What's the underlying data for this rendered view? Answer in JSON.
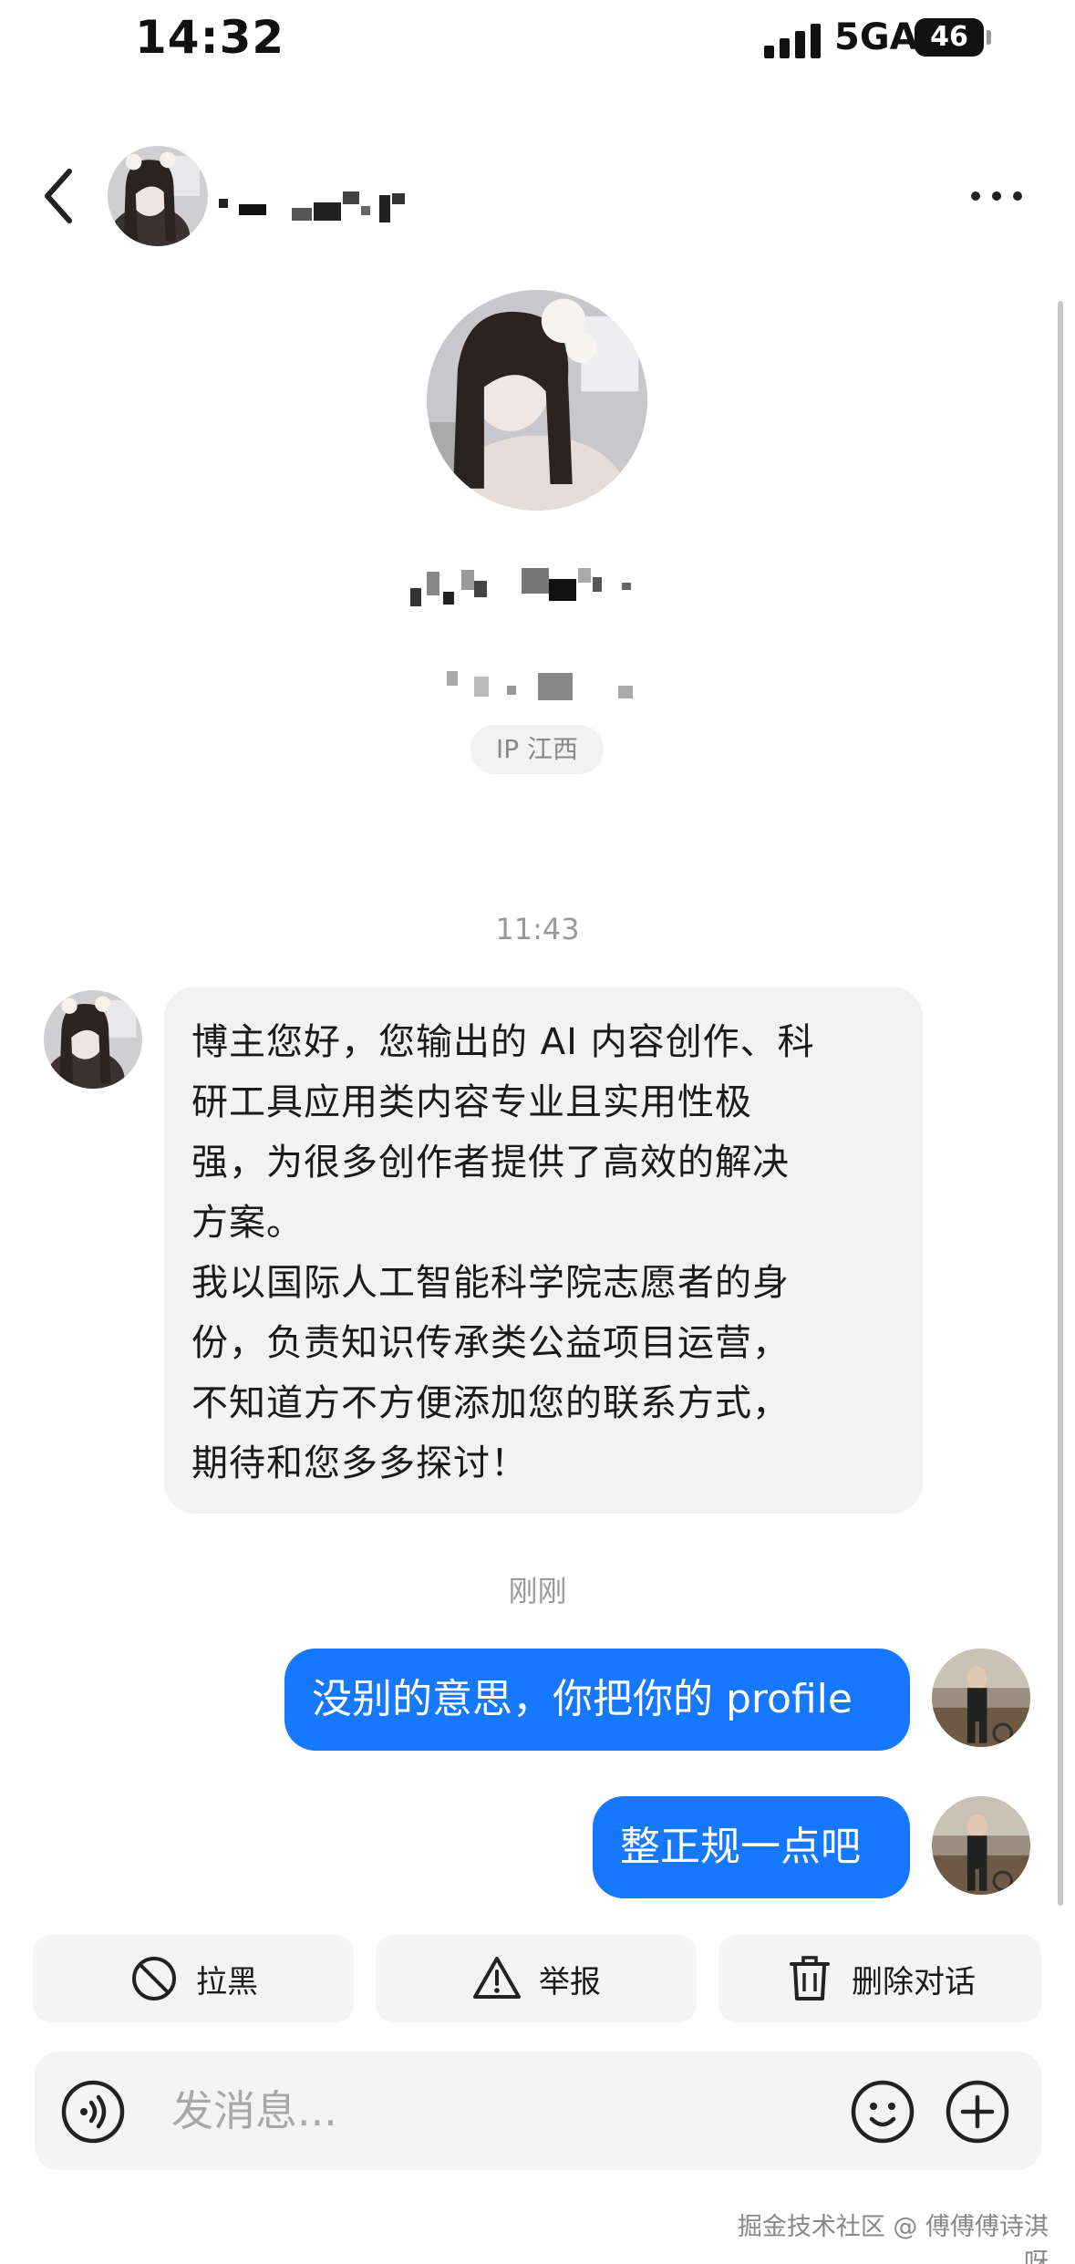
{
  "status_bar": {
    "time": "14:32",
    "network": "5GA",
    "battery": "46"
  },
  "header": {
    "back_icon": "chevron-left-icon",
    "more_icon": "more-horizontal-icon"
  },
  "profile": {
    "ip_location": "IP 江西"
  },
  "conversation": {
    "timestamps": [
      "11:43",
      "刚刚"
    ],
    "incoming": {
      "lines": [
        "博主您好，您输出的 AI 内容创作、科",
        "研工具应用类内容专业且实用性极",
        "强，为很多创作者提供了高效的解决",
        "方案。",
        "我以国际人工智能科学院志愿者的身",
        "份，负责知识传承类公益项目运营，",
        "不知道方不方便添加您的联系方式，",
        "期待和您多多探讨！"
      ]
    },
    "outgoing": [
      "没别的意思，你把你的 profile",
      "整正规一点吧"
    ]
  },
  "actions": [
    {
      "label": "拉黑",
      "icon": "block-icon"
    },
    {
      "label": "举报",
      "icon": "warning-icon"
    },
    {
      "label": "删除对话",
      "icon": "trash-icon"
    }
  ],
  "composer": {
    "placeholder": "发消息...",
    "voice_icon": "voice-icon",
    "emoji_icon": "emoji-icon",
    "plus_icon": "plus-icon"
  },
  "watermark": "掘金技术社区 @ 傅傅傅诗淇呀",
  "colors": {
    "accent": "#1677ff",
    "bubble_incoming": "#f2f2f2",
    "timestamp": "#9a9a9a"
  }
}
